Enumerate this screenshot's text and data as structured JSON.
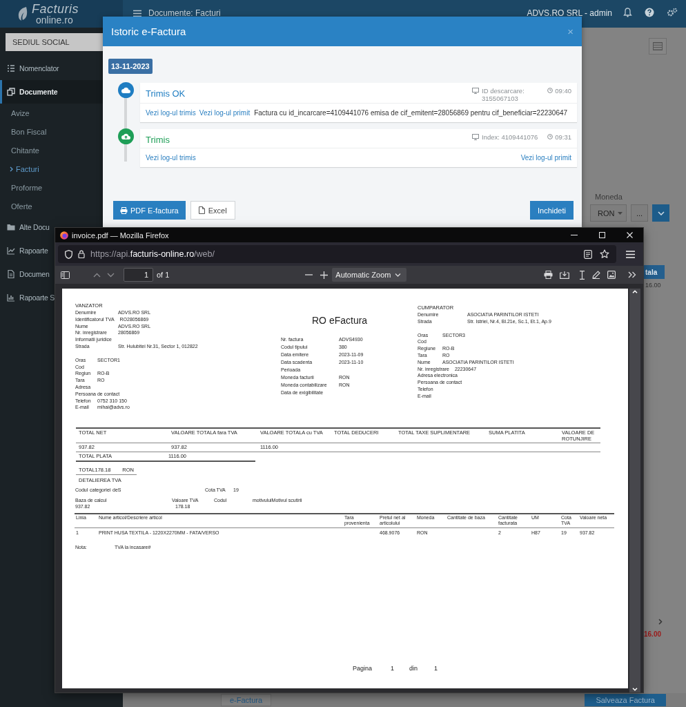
{
  "app": {
    "logo": {
      "line1": "Facturis",
      "line2": "online.ro"
    },
    "breadcrumb": "Documente: Facturi",
    "user": "ADVS.RO SRL - admin",
    "company": "SEDIUL SOCIAL",
    "sidebar": [
      {
        "label": "Nomenclator",
        "kind": "section",
        "selected": false
      },
      {
        "label": "Documente",
        "kind": "section",
        "selected": true
      },
      {
        "label": "Avize",
        "kind": "sub",
        "selected": false
      },
      {
        "label": "Bon Fiscal",
        "kind": "sub",
        "selected": false
      },
      {
        "label": "Chitante",
        "kind": "sub",
        "selected": false
      },
      {
        "label": "Facturi",
        "kind": "sub",
        "selected": true
      },
      {
        "label": "Proforme",
        "kind": "sub",
        "selected": false
      },
      {
        "label": "Oferte",
        "kind": "sub",
        "selected": false
      },
      {
        "label": "Alte Docu",
        "kind": "section",
        "selected": false
      },
      {
        "label": "Rapoarte",
        "kind": "section",
        "selected": false
      },
      {
        "label": "Documen",
        "kind": "section",
        "selected": false
      },
      {
        "label": "Rapoarte S",
        "kind": "section",
        "selected": false
      }
    ],
    "right_panel": {
      "currency_label": "Moneda",
      "currency_value": "RON",
      "more_button": "...",
      "table_header": "tala",
      "row_amount": "16.00",
      "total_amount": "16.00"
    },
    "footer_buttons": {
      "efactura": "e-Factura",
      "save": "Salveaza Factura"
    }
  },
  "modal": {
    "title": "Istoric e-Factura",
    "close": "×",
    "date": "13-11-2023",
    "events": [
      {
        "kind": "download",
        "title": "Trimis OK",
        "color": "#1f7dc2",
        "meta": "ID descarcare: 3155067103",
        "time": "09:40",
        "links": [
          "Vezi log-ul trimis",
          "Vezi log-ul primit"
        ],
        "message": "Factura cu id_incarcare=4109441076 emisa de cif_emitent=28056869 pentru cif_beneficiar=22230647"
      },
      {
        "kind": "upload",
        "title": "Trimis",
        "color": "#1e9e57",
        "meta": "Index: 4109441076",
        "time": "09:31",
        "links": [
          "Vezi log-ul trimis",
          "Vezi log-ul primit"
        ]
      }
    ],
    "buttons": {
      "pdf": "PDF E-factura",
      "excel": "Excel",
      "close": "Inchideti"
    }
  },
  "firefox": {
    "title": "invoice.pdf — Mozilla Firefox",
    "url": {
      "prefix": "https://api.",
      "domain": "facturis-online.ro",
      "path": "/web/"
    },
    "page_number": "1",
    "page_count": "of 1",
    "zoom": "Automatic Zoom"
  },
  "invoice": {
    "seller": {
      "heading": "VANZATOR",
      "groups": [
        [
          {
            "label": "Denumire",
            "value": "ADVS.RO SRL"
          },
          {
            "label": "Identificatorul TVA",
            "value": "RO28056869"
          },
          {
            "label": "Nume",
            "value": "ADVS.RO SRL"
          },
          {
            "label": "Nr. inregistrare",
            "value": "28056869"
          },
          {
            "label": "Informatii juridice"
          },
          {
            "label": "Strada",
            "value": "Str. Hulubitei Nr.31, Sector 1, 012822"
          }
        ],
        [
          {
            "label": "Oras",
            "value": "SECTOR1"
          },
          {
            "label": "Cod"
          },
          {
            "label": "Regiun",
            "value": "RO-B"
          },
          {
            "label": "Tara",
            "value": "RO"
          },
          {
            "label": "Adresa"
          },
          {
            "label": "Persoana de contact"
          },
          {
            "label": "Telefon",
            "value": "0752 310 150"
          },
          {
            "label": "E-mail",
            "value": "mihai@advs.ro"
          }
        ]
      ]
    },
    "title": "RO eFactura",
    "details": [
      {
        "label": "Nr. factura",
        "value": "ADVS4930"
      },
      {
        "label": "Codul tipului",
        "value": "380"
      },
      {
        "label": "Data emitere",
        "value": "2023-11-09"
      },
      {
        "label": "Data scadenta",
        "value": "2023-11-10"
      },
      {
        "label": "Perioada"
      },
      {
        "label": "Moneda facturii",
        "value": "RON"
      },
      {
        "label": "Moneda contabilizare",
        "value": "RON"
      },
      {
        "label": "Data de exigibilitate"
      }
    ],
    "buyer": {
      "heading": "CUMPARATOR",
      "groups": [
        [
          {
            "label": "Denumire",
            "value": "ASOCIATIA PARINTILOR ISTETI"
          },
          {
            "label": "Strada",
            "value": "Str. Istriei, Nr.4, Bl.21e, Sc.1, Et.1, Ap.9"
          }
        ],
        [
          {
            "label": "Oras",
            "value": "SECTOR3"
          },
          {
            "label": "Cod"
          },
          {
            "label": "Regiune",
            "value": "RO-B"
          },
          {
            "label": "Tara",
            "value": "RO"
          },
          {
            "label": "Nume",
            "value": "ASOCIATIA PARINTILOR ISTETI"
          },
          {
            "label": "Nr. inregistrare",
            "value": "22230647"
          },
          {
            "label": "Adresa electronica"
          },
          {
            "label": "Persoana de contact"
          },
          {
            "label": "Telefon"
          },
          {
            "label": "E-mail"
          }
        ]
      ]
    },
    "totals": {
      "columns": [
        "TOTAL NET",
        "VALOARE TOTALA  fara TVA",
        "VALOARE TOTALA cu TVA",
        "TOTAL DEDUCERI",
        "TOTAL TAXE SUPLIMENTARE",
        "SUMA PLATITA",
        "VALOARE DE ROTUNJIRE"
      ],
      "values": [
        "937.82",
        "937.82",
        "1116.00"
      ],
      "payable_label": "TOTAL PLATA",
      "payable_value": "1116.00"
    },
    "vat_total": {
      "label": "TOTAL",
      "value": "178.18",
      "currency": "RON"
    },
    "vat_detail": {
      "heading": "DETALIEREA TVA",
      "category_line": [
        "Codul",
        "categoriei",
        "deS",
        "Cota TVA",
        "19"
      ],
      "columns": [
        {
          "label": "Baza de calcul",
          "value": "937.82"
        },
        {
          "label": "Valoare TVA",
          "value": "178.18"
        },
        {
          "label": "Codul"
        },
        {
          "label": "motivuluiMotivul scutirii"
        }
      ]
    },
    "items": {
      "columns": [
        "Linia",
        "Nume articol/Descriere articol",
        "Tara provenienta",
        "Pretul net al articolului",
        "Moneda",
        "Cantitate de baza",
        "Cantitate facturata",
        "UM",
        "Cota TVA",
        "Valoare neta"
      ],
      "rows": [
        [
          "1",
          "PRINT HUSA TEXTILA - 1220X2270MM - FATA/VERSO",
          "",
          "468.9076",
          "RON",
          "",
          "2",
          "H87",
          "19",
          "937.82"
        ]
      ]
    },
    "note": {
      "label": "Nota:",
      "value": "TVA la incasare#"
    },
    "footer": [
      "Pagina",
      "1",
      "din",
      "1"
    ]
  }
}
